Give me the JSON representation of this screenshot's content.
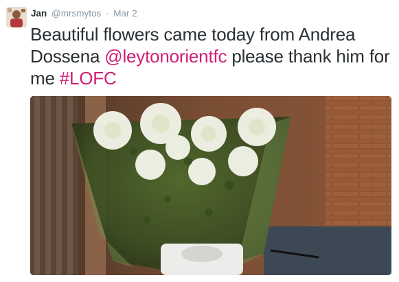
{
  "tweet": {
    "author": {
      "fullname": "Jan",
      "username": "@mrsmytos",
      "avatar_icon": "user-avatar"
    },
    "separator": "·",
    "timestamp": "Mar 2",
    "text": {
      "part1": "Beautiful flowers came today from Andrea Dossena ",
      "mention": "@leytonorientfc",
      "part2": " please thank him for me ",
      "hashtag": "#LOFC"
    },
    "media": {
      "description_icon": "photo-image"
    },
    "colors": {
      "link": "#cf1e75",
      "meta": "#8899a6",
      "text": "#292f33"
    }
  }
}
